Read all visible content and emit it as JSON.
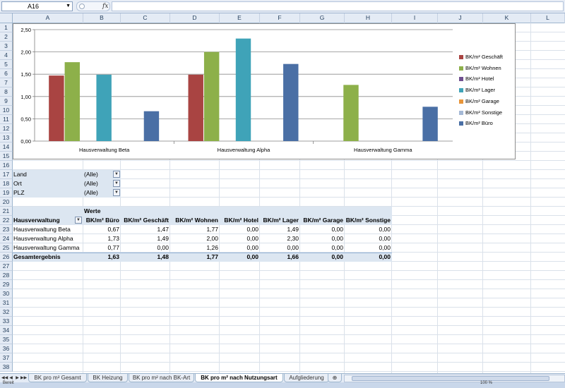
{
  "formula_bar": {
    "name_box": "A16",
    "fx": "fx",
    "formula": ""
  },
  "columns": [
    "A",
    "B",
    "C",
    "D",
    "E",
    "F",
    "G",
    "H",
    "I",
    "J",
    "K",
    "L"
  ],
  "rows": [
    "1",
    "2",
    "3",
    "4",
    "5",
    "6",
    "7",
    "8",
    "9",
    "10",
    "11",
    "12",
    "13",
    "14",
    "15",
    "16",
    "17",
    "18",
    "19",
    "20",
    "21",
    "22",
    "23",
    "24",
    "25",
    "26",
    "27",
    "28",
    "29",
    "30",
    "31",
    "32",
    "33",
    "34",
    "35",
    "36",
    "37",
    "38"
  ],
  "filters": [
    {
      "label": "Land",
      "value": "(Alle)"
    },
    {
      "label": "Ort",
      "value": "(Alle)"
    },
    {
      "label": "PLZ",
      "value": "(Alle)"
    }
  ],
  "pivot": {
    "werte_label": "Werte",
    "row_field": "Hausverwaltung",
    "headers": [
      "BK/m² Büro",
      "BK/m² Geschäft",
      "BK/m² Wohnen",
      "BK/m² Hotel",
      "BK/m² Lager",
      "BK/m² Garage",
      "BK/m² Sonstige"
    ],
    "rows": [
      {
        "name": "Hausverwaltung Beta",
        "values": [
          "0,67",
          "1,47",
          "1,77",
          "0,00",
          "1,49",
          "0,00",
          "0,00"
        ]
      },
      {
        "name": "Hausverwaltung Alpha",
        "values": [
          "1,73",
          "1,49",
          "2,00",
          "0,00",
          "2,30",
          "0,00",
          "0,00"
        ]
      },
      {
        "name": "Hausverwaltung Gamma",
        "values": [
          "0,77",
          "0,00",
          "1,26",
          "0,00",
          "0,00",
          "0,00",
          "0,00"
        ]
      }
    ],
    "total": {
      "name": "Gesamtergebnis",
      "values": [
        "1,63",
        "1,48",
        "1,77",
        "0,00",
        "1,66",
        "0,00",
        "0,00"
      ]
    }
  },
  "chart_data": {
    "type": "bar",
    "categories": [
      "Hausverwaltung Beta",
      "Hausverwaltung Alpha",
      "Hausverwaltung Gamma"
    ],
    "series": [
      {
        "name": "BK/m² Geschäft",
        "color": "#a94442",
        "values": [
          1.47,
          1.49,
          0
        ]
      },
      {
        "name": "BK/m² Wohnen",
        "color": "#8db04a",
        "values": [
          1.77,
          2.0,
          1.26
        ]
      },
      {
        "name": "BK/m² Hotel",
        "color": "#6f4f8f",
        "values": [
          0,
          0,
          0
        ]
      },
      {
        "name": "BK/m² Lager",
        "color": "#3fa3b8",
        "values": [
          1.49,
          2.3,
          0
        ]
      },
      {
        "name": "BK/m² Garage",
        "color": "#e8953a",
        "values": [
          0,
          0,
          0
        ]
      },
      {
        "name": "BK/m² Sonstige",
        "color": "#a5b9d6",
        "values": [
          0,
          0,
          0
        ]
      },
      {
        "name": "BK/m² Büro",
        "color": "#4a6fa5",
        "values": [
          0.67,
          1.73,
          0.77
        ]
      }
    ],
    "yticks": [
      "0,00",
      "0,50",
      "1,00",
      "1,50",
      "2,00",
      "2,50"
    ],
    "ylim": [
      0,
      2.5
    ],
    "grid": true,
    "legend": "right"
  },
  "sheet_tabs": [
    {
      "label": "BK pro m² Gesamt",
      "active": false
    },
    {
      "label": "BK Heizung",
      "active": false
    },
    {
      "label": "BK pro m² nach BK-Art",
      "active": false
    },
    {
      "label": "BK pro m² nach Nutzungsart",
      "active": true
    },
    {
      "label": "Aufgliederung",
      "active": false
    }
  ],
  "status": {
    "left": "Bereit",
    "zoom": "100 %"
  }
}
